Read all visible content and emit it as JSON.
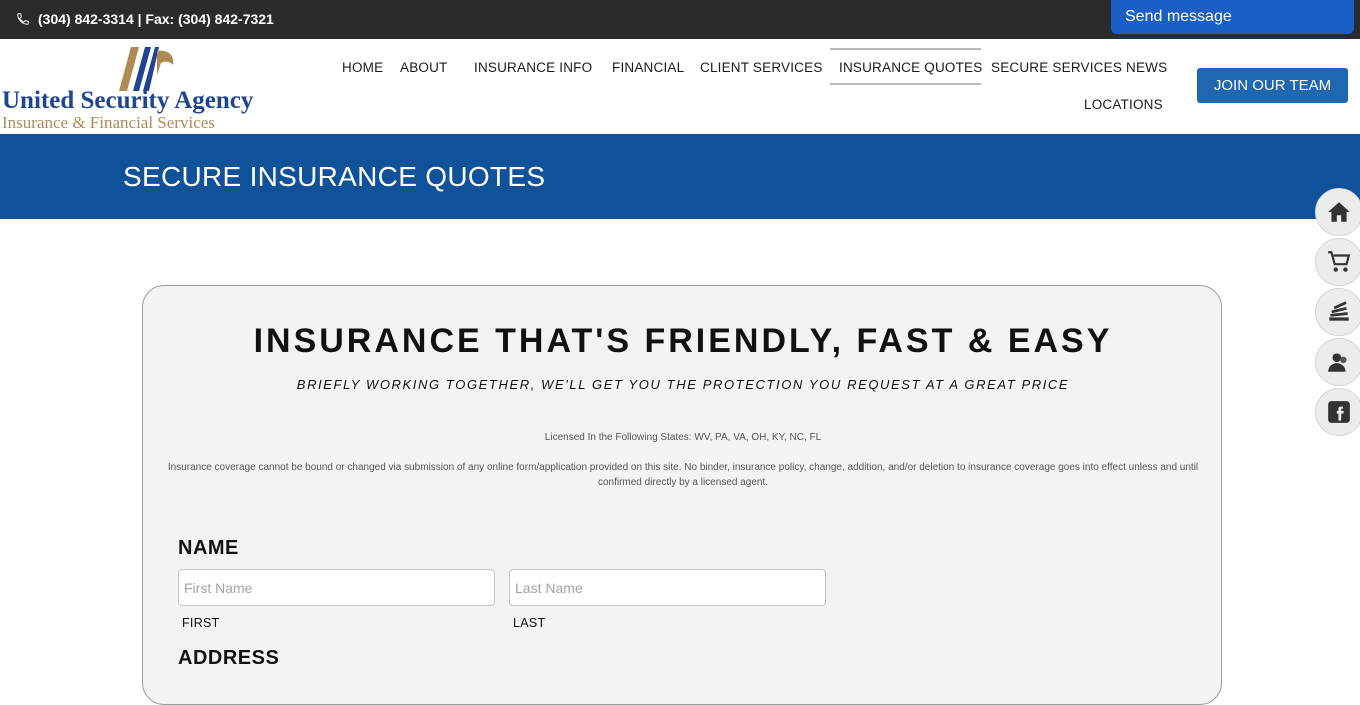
{
  "topbar": {
    "contact": "(304) 842-3314 | Fax: (304) 842-7321",
    "send_message": "Send message"
  },
  "brand": {
    "name": "United Security Agency",
    "subtitle": "Insurance & Financial Services",
    "primary_color": "#1e4592",
    "gold_color": "#b08a53"
  },
  "nav": {
    "items": [
      "HOME",
      "ABOUT",
      "INSURANCE INFO",
      "FINANCIAL",
      "CLIENT SERVICES",
      "INSURANCE QUOTES",
      "SECURE SERVICES",
      "NEWS",
      "LOCATIONS"
    ],
    "active": "INSURANCE QUOTES",
    "join_button": "JOIN OUR TEAM"
  },
  "banner": {
    "title": "SECURE INSURANCE QUOTES",
    "color": "#0f5299"
  },
  "side_icons": [
    "home-icon",
    "cart-icon",
    "stack-icon",
    "person-icon",
    "facebook-icon"
  ],
  "form": {
    "heading": "INSURANCE THAT'S FRIENDLY, FAST & EASY",
    "tagline": "BRIEFLY WORKING TOGETHER, WE'LL GET YOU THE PROTECTION YOU REQUEST AT A GREAT PRICE",
    "licensed": "Licensed In the Following States: WV, PA, VA, OH, KY, NC, FL",
    "disclaimer": "Insurance coverage cannot be bound or changed via submission of any online form/application provided on this site. No binder, insurance policy, change, addition, and/or deletion to insurance coverage goes into effect unless and until confirmed directly by a licensed agent.",
    "name_label": "NAME",
    "first_name": {
      "value": "",
      "placeholder": "First Name",
      "sublabel": "FIRST"
    },
    "last_name": {
      "value": "",
      "placeholder": "Last Name",
      "sublabel": "LAST"
    },
    "address_label": "ADDRESS"
  }
}
